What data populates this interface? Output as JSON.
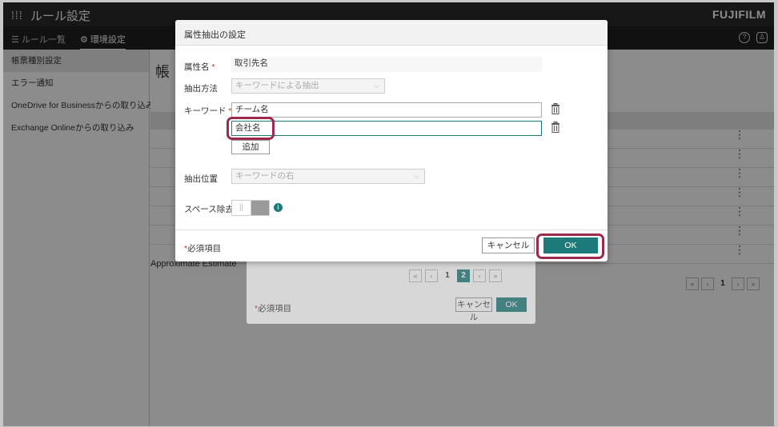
{
  "app": {
    "apps_icon": "apps-grid-icon",
    "title": "ルール設定",
    "brand": "FUJIFILM"
  },
  "subnav": {
    "rule_list": "☰ ルール一覧",
    "env_settings": "⚙ 環境設定"
  },
  "sidebar": {
    "items": [
      {
        "label": "帳票種別設定"
      },
      {
        "label": "エラー通知"
      },
      {
        "label": "OneDrive for Businessからの取り込み"
      },
      {
        "label": "Exchange Onlineからの取り込み"
      }
    ]
  },
  "main": {
    "page_title": "帳",
    "last_row_label": "Approximate Estimate",
    "pager": [
      "«",
      "‹",
      "1",
      "›",
      "»"
    ]
  },
  "bg_dialog": {
    "pager": [
      "«",
      "‹",
      "1",
      "2",
      "›",
      "»"
    ],
    "required_note": "必須項目",
    "cancel": "キャンセル",
    "ok": "OK"
  },
  "dialog": {
    "title": "属性抽出の設定",
    "attr_name_label": "属性名",
    "attr_name_value": "取引先名",
    "method_label": "抽出方法",
    "method_value": "キーワードによる抽出",
    "keyword_label": "キーワード",
    "keywords": [
      "チーム名",
      "会社名"
    ],
    "add_button": "追加",
    "position_label": "抽出位置",
    "position_value": "キーワードの右",
    "space_label": "スペース除去",
    "toggle_text": "||",
    "info_icon": "i",
    "required_note": "必須項目",
    "required_mark": "*",
    "cancel": "キャンセル",
    "ok": "OK"
  },
  "colors": {
    "accent": "#1d7a7a",
    "highlight": "#9c2a4d",
    "topbar": "#2b2b2b"
  }
}
